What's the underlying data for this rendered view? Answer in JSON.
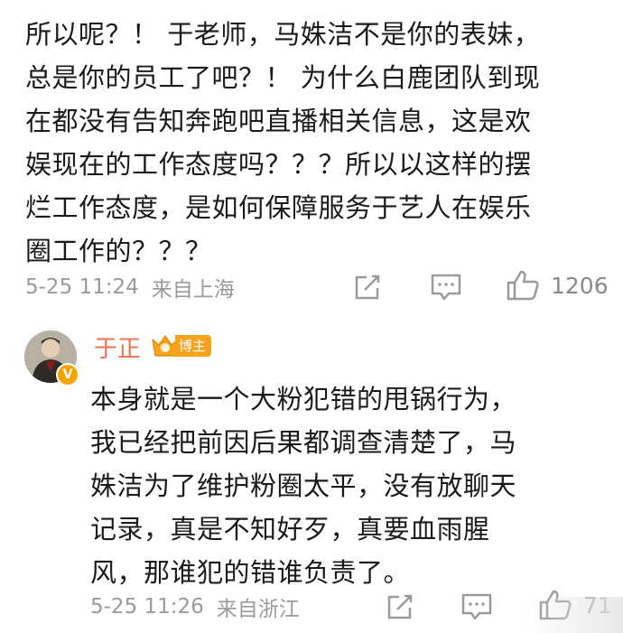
{
  "post": {
    "lines": [
      "所以呢？！ 于老师，马姝洁不是你的表妹，",
      "总是你的员工了吧？！ 为什么白鹿团队到现",
      "在都没有告知奔跑吧直播相关信息，这是欢",
      "娱现在的工作态度吗？？？所以以这样的摆",
      "烂工作态度，是如何保障服务于艺人在娱乐",
      "圈工作的？？？"
    ],
    "time": "5-25 11:24",
    "location": "来自上海",
    "like_count": "1206"
  },
  "reply": {
    "name": "于正",
    "badge": "博主",
    "v_badge": "V",
    "lines": [
      "本身就是一个大粉犯错的甩锅行为，",
      "我已经把前因后果都调查清楚了，马",
      "姝洁为了维护粉圈太平，没有放聊天",
      "记录，真是不知好歹，真要血雨腥",
      "风，那谁犯的错谁负责了。"
    ],
    "time": "5-25 11:26",
    "location": "来自浙江",
    "like_count": "71"
  },
  "icons": {
    "share": "share-icon",
    "comment": "comment-icon",
    "like": "thumbs-up-icon"
  },
  "colors": {
    "name": "#eb7350",
    "badge": "#f7a21d",
    "meta": "#9a9a9a"
  }
}
